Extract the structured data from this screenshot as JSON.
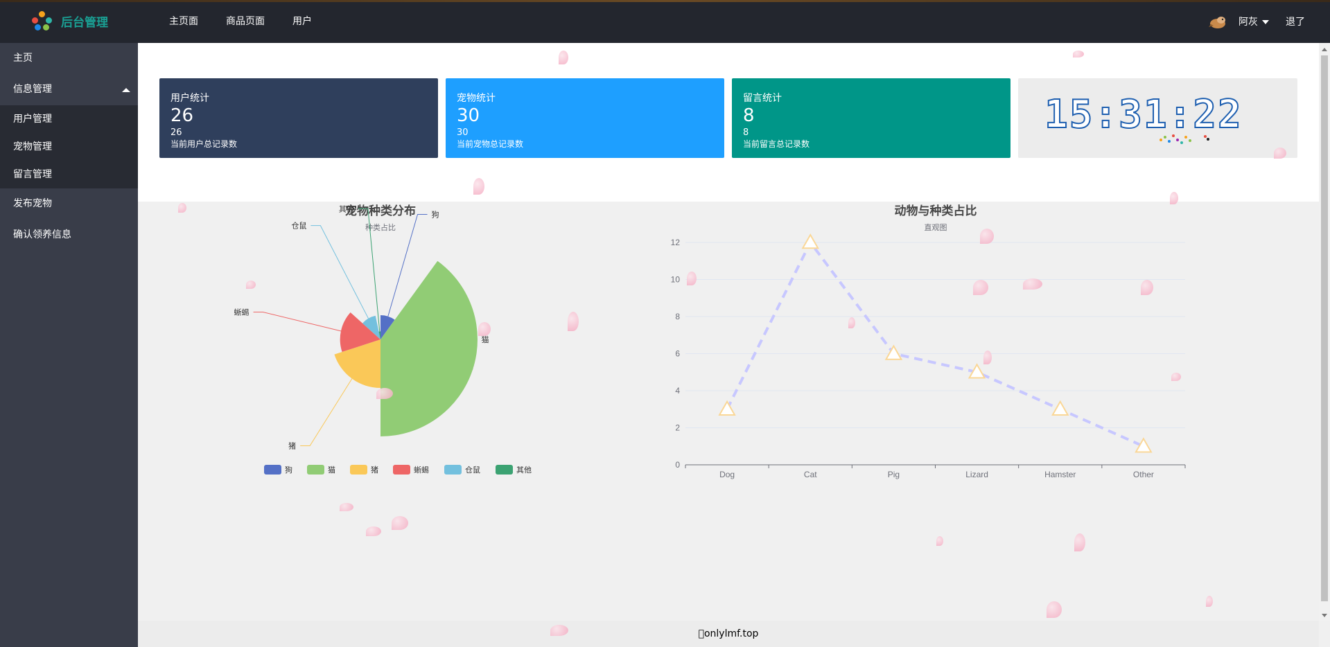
{
  "header": {
    "brand": "后台管理",
    "nav": [
      "主页面",
      "商品页面",
      "用户"
    ],
    "user_name": "阿灰",
    "logout": "退了"
  },
  "sidebar": {
    "items": [
      {
        "label": "主页"
      },
      {
        "label": "信息管理",
        "expanded": true
      },
      {
        "label": "用户管理"
      },
      {
        "label": "宠物管理"
      },
      {
        "label": "留言管理"
      },
      {
        "label": "发布宠物"
      },
      {
        "label": "确认领养信息"
      }
    ]
  },
  "cards": [
    {
      "title": "用户统计",
      "number": "26",
      "sub": "26",
      "desc": "当前用户总记录数",
      "color": "#2f3f5c"
    },
    {
      "title": "宠物统计",
      "number": "30",
      "sub": "30",
      "desc": "当前宠物总记录数",
      "color": "#1e9fff"
    },
    {
      "title": "留言统计",
      "number": "8",
      "sub": "8",
      "desc": "当前留言总记录数",
      "color": "#009688"
    }
  ],
  "clock": "15:31:22",
  "footer": "onlylmf.top",
  "colors": {
    "header": "#23262e",
    "sidebar": "#393d49",
    "brand": "#1aa094"
  },
  "chart_data": [
    {
      "type": "pie",
      "variant": "rose",
      "title": "宠物种类分布",
      "subtitle": "种类占比",
      "categories": [
        "狗",
        "猫",
        "猪",
        "蜥蜴",
        "仓鼠",
        "其他"
      ],
      "values": [
        3,
        12,
        6,
        5,
        3,
        1
      ],
      "colors": [
        "#5470c6",
        "#91cc75",
        "#fac858",
        "#ee6666",
        "#73c0de",
        "#3ba272"
      ],
      "legend": "bottom"
    },
    {
      "type": "line",
      "title": "动物与种类占比",
      "subtitle": "直观图",
      "categories": [
        "Dog",
        "Cat",
        "Pig",
        "Lizard",
        "Hamster",
        "Other"
      ],
      "values": [
        3,
        12,
        6,
        5,
        3,
        1
      ],
      "ylim": [
        0,
        12
      ],
      "yticks": [
        0,
        2,
        4,
        6,
        8,
        10,
        12
      ],
      "line_style": "dashed",
      "line_color": "#c7c7ff",
      "marker": "triangle",
      "marker_color": "#fad797",
      "grid": true
    }
  ]
}
